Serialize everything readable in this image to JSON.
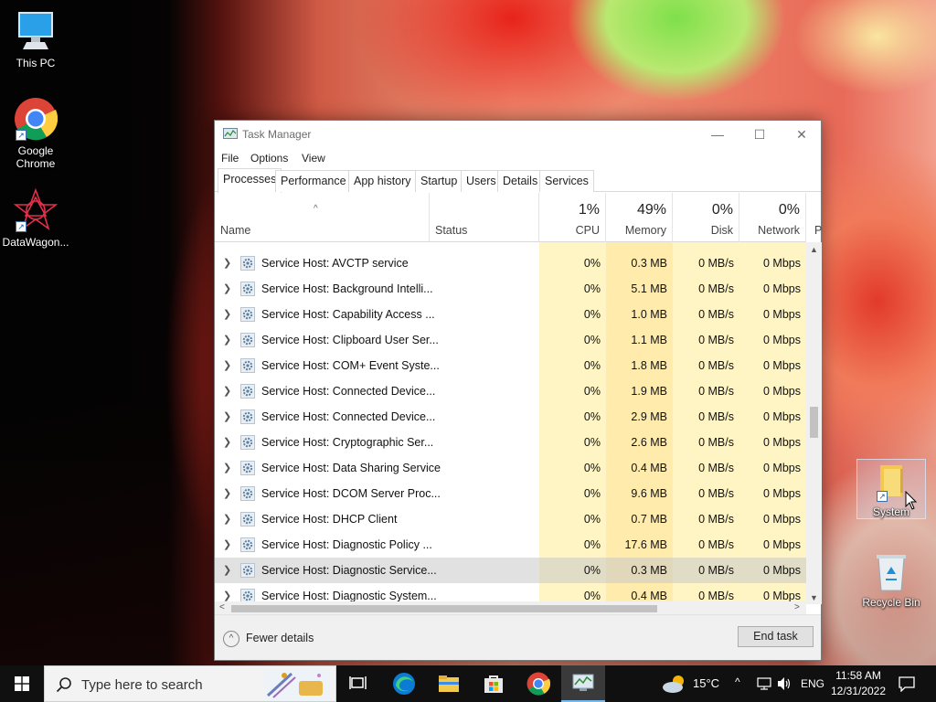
{
  "desktop": {
    "icons": [
      {
        "label": "This PC"
      },
      {
        "label": "Google\nChrome"
      },
      {
        "label": "DataWagon..."
      },
      {
        "label": "System"
      },
      {
        "label": "Recycle Bin"
      }
    ]
  },
  "window": {
    "title": "Task Manager",
    "controls": {
      "minimize": "—",
      "maximize": "☐",
      "close": "✕"
    },
    "menu": [
      "File",
      "Options",
      "View"
    ],
    "tabs": [
      "Processes",
      "Performance",
      "App history",
      "Startup",
      "Users",
      "Details",
      "Services"
    ],
    "active_tab": "Processes",
    "columns": {
      "name": "Name",
      "status": "Status",
      "cpu": {
        "pct": "1%",
        "label": "CPU"
      },
      "memory": {
        "pct": "49%",
        "label": "Memory"
      },
      "disk": {
        "pct": "0%",
        "label": "Disk"
      },
      "network": {
        "pct": "0%",
        "label": "Network"
      },
      "power_partial": "P"
    },
    "rows": [
      {
        "name": "Service Host: AVCTP service",
        "cpu": "0%",
        "memory": "0.3 MB",
        "disk": "0 MB/s",
        "network": "0 Mbps"
      },
      {
        "name": "Service Host: Background Intelli...",
        "cpu": "0%",
        "memory": "5.1 MB",
        "disk": "0 MB/s",
        "network": "0 Mbps"
      },
      {
        "name": "Service Host: Capability Access ...",
        "cpu": "0%",
        "memory": "1.0 MB",
        "disk": "0 MB/s",
        "network": "0 Mbps"
      },
      {
        "name": "Service Host: Clipboard User Ser...",
        "cpu": "0%",
        "memory": "1.1 MB",
        "disk": "0 MB/s",
        "network": "0 Mbps"
      },
      {
        "name": "Service Host: COM+ Event Syste...",
        "cpu": "0%",
        "memory": "1.8 MB",
        "disk": "0 MB/s",
        "network": "0 Mbps"
      },
      {
        "name": "Service Host: Connected Device...",
        "cpu": "0%",
        "memory": "1.9 MB",
        "disk": "0 MB/s",
        "network": "0 Mbps"
      },
      {
        "name": "Service Host: Connected Device...",
        "cpu": "0%",
        "memory": "2.9 MB",
        "disk": "0 MB/s",
        "network": "0 Mbps"
      },
      {
        "name": "Service Host: Cryptographic Ser...",
        "cpu": "0%",
        "memory": "2.6 MB",
        "disk": "0 MB/s",
        "network": "0 Mbps"
      },
      {
        "name": "Service Host: Data Sharing Service",
        "cpu": "0%",
        "memory": "0.4 MB",
        "disk": "0 MB/s",
        "network": "0 Mbps"
      },
      {
        "name": "Service Host: DCOM Server Proc...",
        "cpu": "0%",
        "memory": "9.6 MB",
        "disk": "0 MB/s",
        "network": "0 Mbps"
      },
      {
        "name": "Service Host: DHCP Client",
        "cpu": "0%",
        "memory": "0.7 MB",
        "disk": "0 MB/s",
        "network": "0 Mbps"
      },
      {
        "name": "Service Host: Diagnostic Policy ...",
        "cpu": "0%",
        "memory": "17.6 MB",
        "disk": "0 MB/s",
        "network": "0 Mbps"
      },
      {
        "name": "Service Host: Diagnostic Service...",
        "cpu": "0%",
        "memory": "0.3 MB",
        "disk": "0 MB/s",
        "network": "0 Mbps",
        "selected": true
      },
      {
        "name": "Service Host: Diagnostic System...",
        "cpu": "0%",
        "memory": "0.4 MB",
        "disk": "0 MB/s",
        "network": "0 Mbps"
      }
    ],
    "footer": {
      "fewer_details": "Fewer details",
      "end_task": "End task"
    }
  },
  "taskbar": {
    "search_placeholder": "Type here to search",
    "pinned": [
      "task-view",
      "edge",
      "file-explorer",
      "store",
      "chrome",
      "task-manager"
    ],
    "weather": "15°C",
    "language": "ENG",
    "time": "11:58 AM",
    "date": "12/31/2022"
  },
  "colors": {
    "accent": "#0078d7",
    "heat_light": "#fff4c4",
    "heat_medium": "#ffecad",
    "selected_row": "#d9d9d9"
  }
}
